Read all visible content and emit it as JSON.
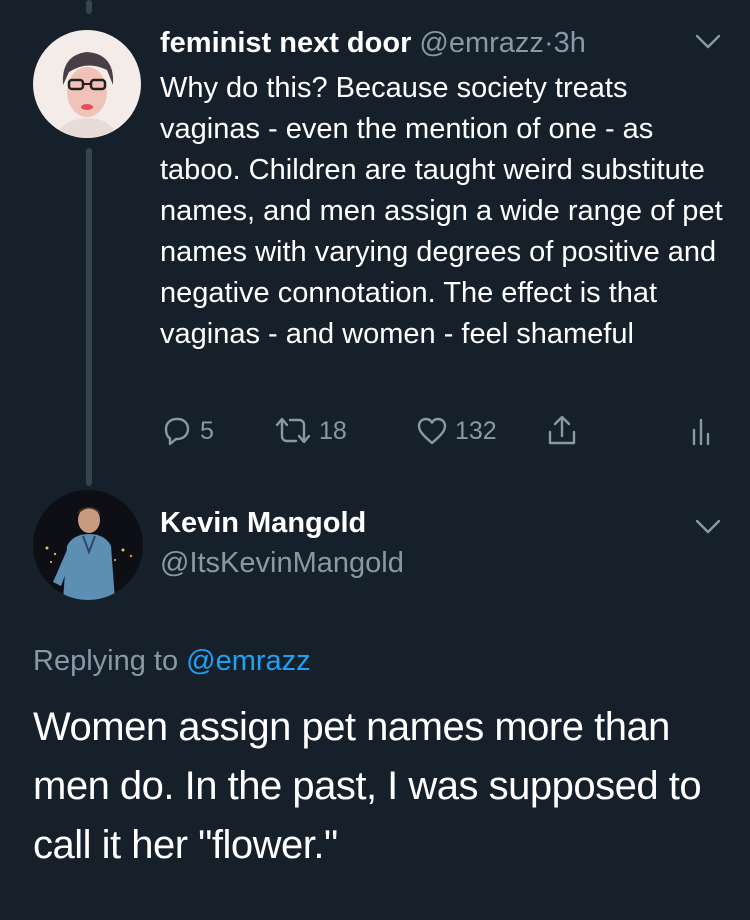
{
  "tweet1": {
    "display_name": "feminist next door",
    "handle": "@emrazz",
    "separator": "·",
    "time": "3h",
    "text": "Why do this? Because society treats vaginas - even the mention of one - as taboo. Children are taught weird substitute names, and men assign a wide range of pet names with varying degrees of positive and negative connotation. The effect is that vaginas - and women - feel shameful",
    "replies": "5",
    "retweets": "18",
    "likes": "132"
  },
  "tweet2": {
    "display_name": "Kevin Mangold",
    "handle": "@ItsKevinMangold",
    "replying_prefix": "Replying to",
    "replying_to": "@emrazz",
    "text": "Women assign pet names more than men do. In the past, I was supposed to call it her \"flower.\""
  },
  "icons": {
    "reply": "reply-icon",
    "retweet": "retweet-icon",
    "like": "heart-icon",
    "share": "share-icon",
    "analytics": "analytics-icon",
    "menu": "chevron-down-icon"
  },
  "colors": {
    "background": "#15202b",
    "text": "#ffffff",
    "secondary": "#8899a6",
    "link": "#1da1f2",
    "thread_line": "#38444d"
  }
}
